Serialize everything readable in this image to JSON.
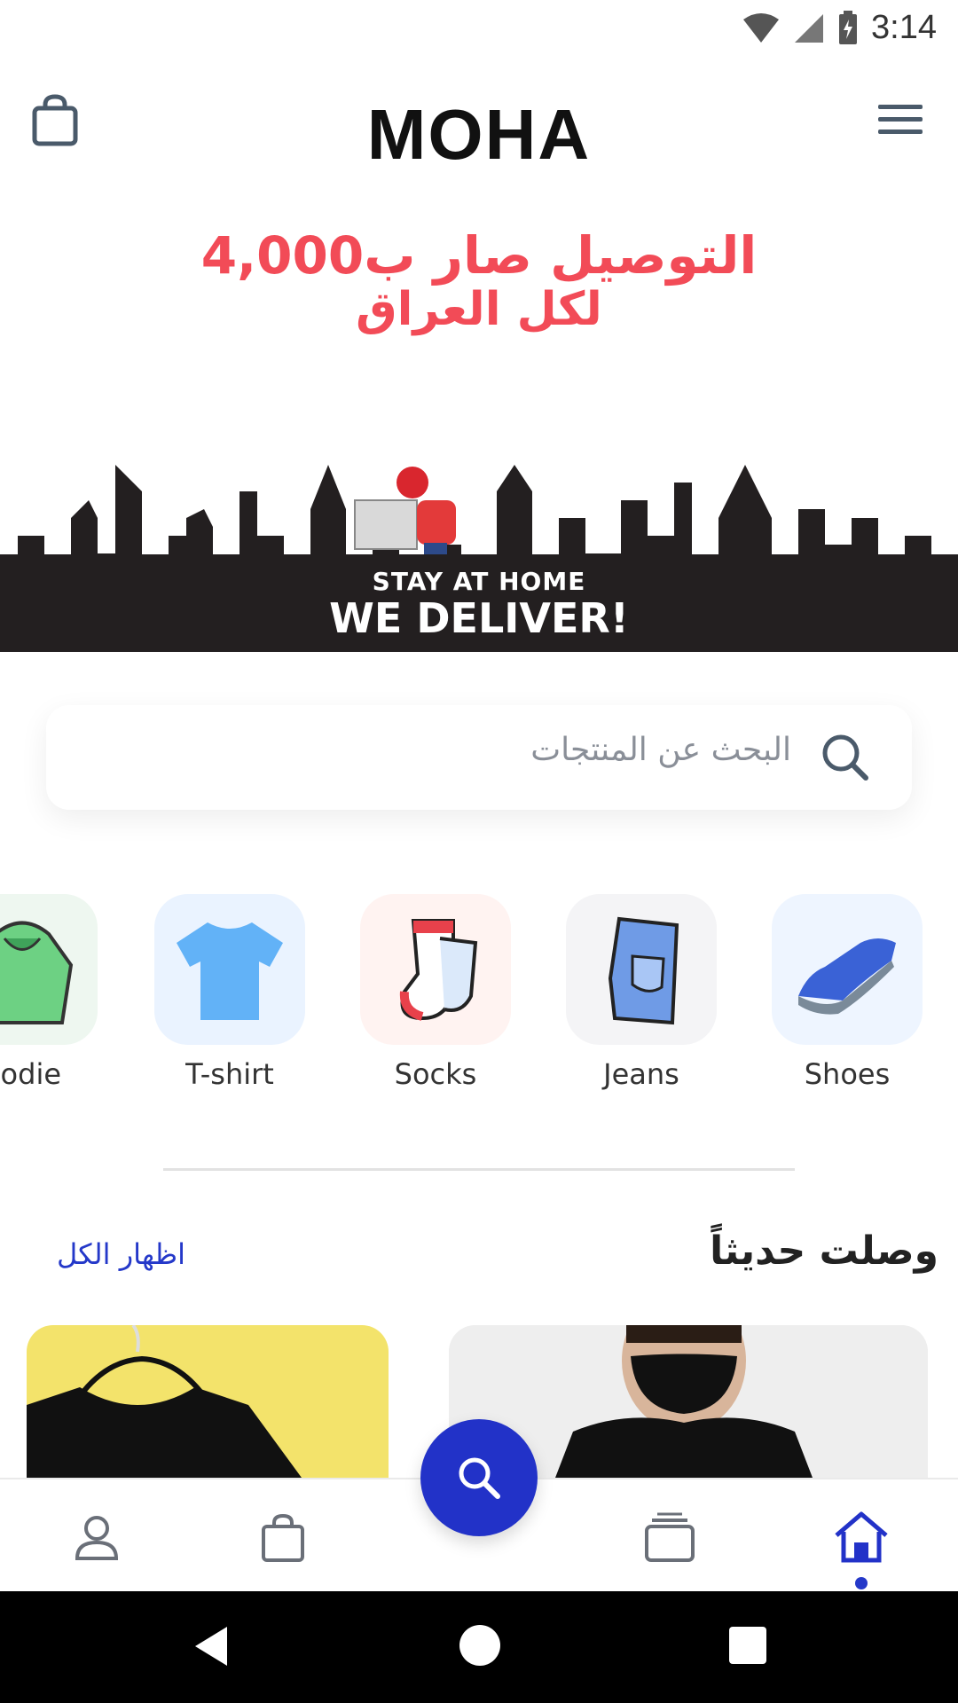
{
  "status_bar": {
    "time": "3:14"
  },
  "header": {
    "logo_text": "MOHA",
    "cart_icon": "shopping-bag-icon",
    "menu_icon": "hamburger-menu-icon"
  },
  "banner": {
    "headline_line1": "التوصيل صار ب4,000",
    "headline_line2": "لكل العراق",
    "tagline_small": "STAY AT HOME",
    "tagline_large": "WE DELIVER!"
  },
  "search": {
    "placeholder": "البحث عن المنتجات",
    "icon": "search-icon"
  },
  "categories": [
    {
      "label": "oodie",
      "icon": "hoodie-icon"
    },
    {
      "label": "T-shirt",
      "icon": "tshirt-icon"
    },
    {
      "label": "Socks",
      "icon": "socks-icon"
    },
    {
      "label": "Jeans",
      "icon": "jeans-icon"
    },
    {
      "label": "Shoes",
      "icon": "shoe-icon"
    }
  ],
  "new_arrivals": {
    "title": "وصلت حديثاً",
    "show_all": "اظهار الكل"
  },
  "bottom_nav": {
    "items": [
      "profile-icon",
      "bag-icon",
      "search-icon",
      "collections-icon",
      "home-icon"
    ],
    "active": "home-icon"
  },
  "colors": {
    "accent": "#2232c8",
    "banner_red": "#f24b57",
    "banner_dark": "#231f20"
  }
}
